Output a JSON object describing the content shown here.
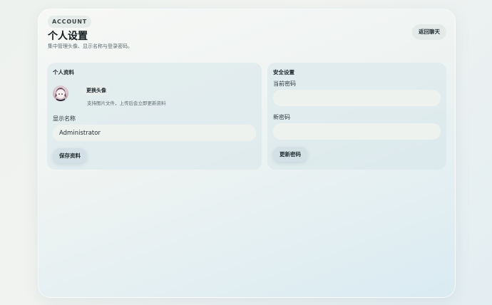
{
  "header": {
    "badge": "ACCOUNT",
    "title": "个人设置",
    "subtitle": "集中管理头像、显示名称与登录密码。",
    "back_label": "返回聊天"
  },
  "profile": {
    "title": "个人资料",
    "change_avatar_label": "更换头像",
    "avatar_hint": "支持图片文件，上传后会立即更新资料",
    "display_name_label": "显示名称",
    "display_name_value": "Administrator",
    "save_label": "保存资料"
  },
  "security": {
    "title": "安全设置",
    "current_password_label": "当前密码",
    "current_password_value": "",
    "new_password_label": "新密码",
    "new_password_value": "",
    "update_label": "更新密码"
  },
  "icons": {
    "avatar": "avatar-image"
  }
}
